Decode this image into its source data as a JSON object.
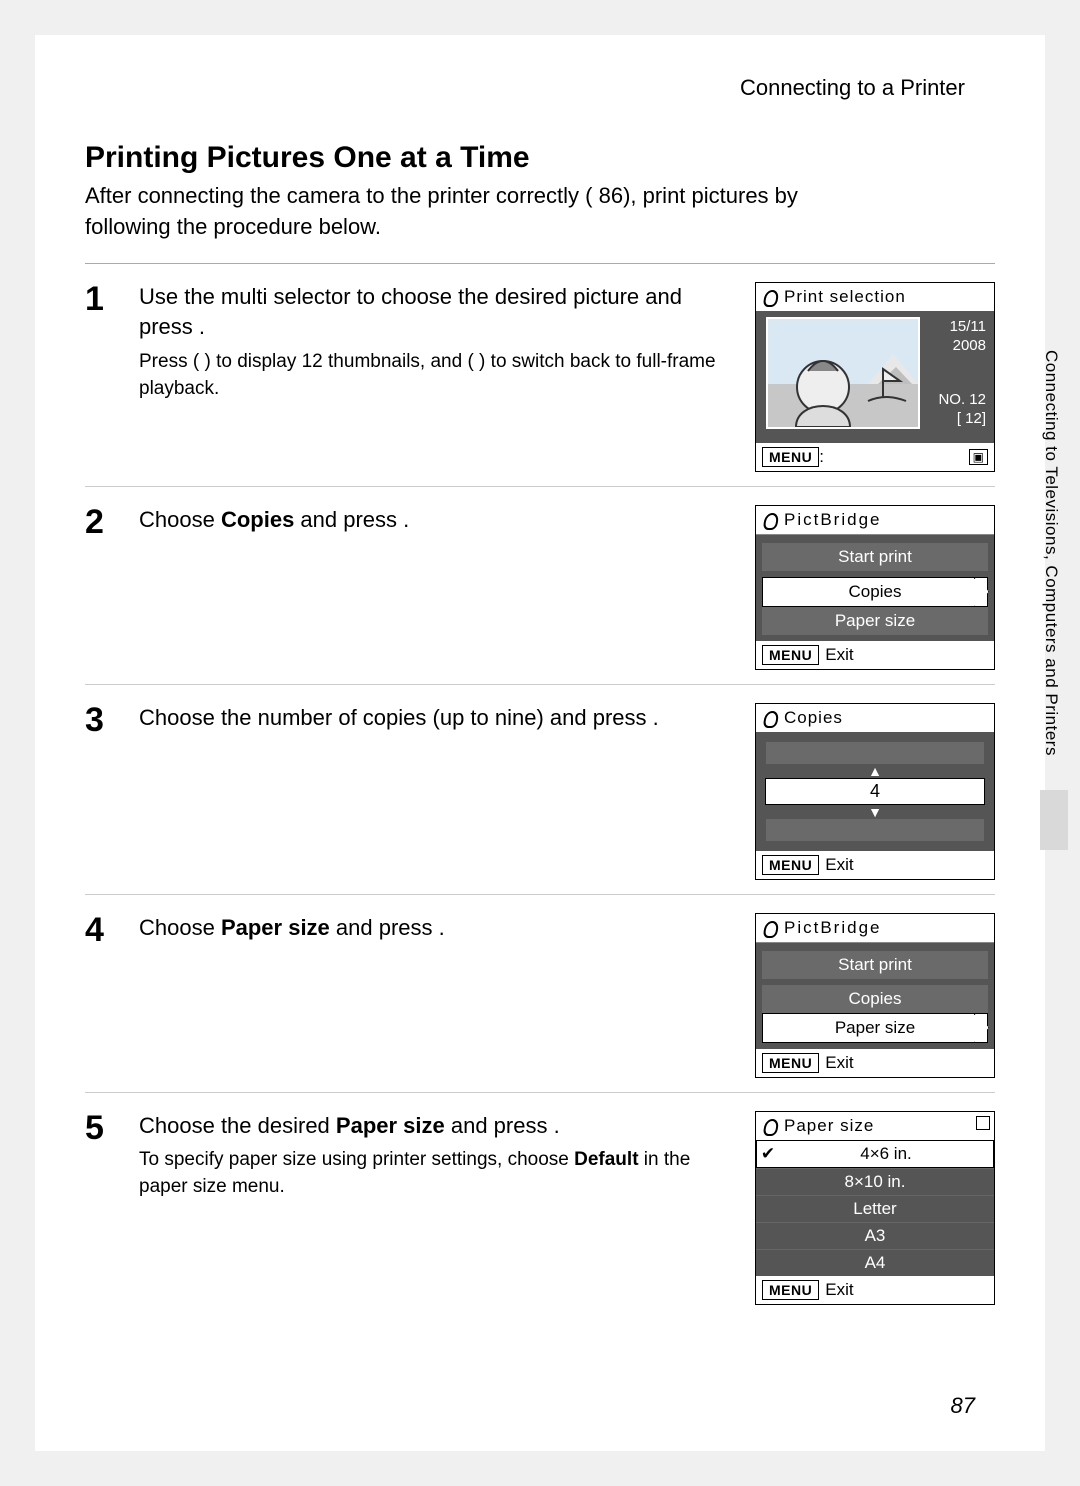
{
  "running_head": "Connecting to a Printer",
  "side_tab": "Connecting to Televisions, Computers and Printers",
  "page_number": "87",
  "section_title": "Printing Pictures One at a Time",
  "intro_a": "After connecting the camera to the printer correctly (",
  "intro_ref": "86",
  "intro_b": "), print pictures by following the procedure below.",
  "steps": {
    "s1": {
      "num": "1",
      "head_a": "Use the multi selector to choose the desired picture and press ",
      "head_b": ".",
      "note_a": "Press ",
      "note_b": " ( ) to display 12 thumbnails, and ",
      "note_c": " ( ) to switch back to full-frame playback."
    },
    "s2": {
      "num": "2",
      "head_a": "Choose ",
      "bold": "Copies",
      "head_b": " and press ",
      "head_c": "."
    },
    "s3": {
      "num": "3",
      "head_a": "Choose the number of copies (up to nine) and press ",
      "head_b": "."
    },
    "s4": {
      "num": "4",
      "head_a": "Choose ",
      "bold": "Paper size",
      "head_b": " and press ",
      "head_c": "."
    },
    "s5": {
      "num": "5",
      "head_a": "Choose the desired ",
      "bold": "Paper size",
      "head_b": " and press ",
      "head_c": ".",
      "note_a": "To specify paper size using printer settings, choose ",
      "note_bold": "Default",
      "note_b": " in the paper size menu."
    }
  },
  "screens": {
    "s1": {
      "title": "Print selection",
      "date1": "15/11",
      "date2": "2008",
      "no_label": "NO. 12",
      "count": "[  12]",
      "menu": "MENU",
      "menu_sub": ":"
    },
    "pb": {
      "title": "PictBridge",
      "opt_start": "Start print",
      "opt_copies": "Copies",
      "opt_paper": "Paper size",
      "exit": "Exit",
      "menu": "MENU"
    },
    "copies": {
      "title": "Copies",
      "value": "4",
      "exit": "Exit",
      "menu": "MENU"
    },
    "paper": {
      "title": "Paper size",
      "opts": [
        "4×6 in.",
        "8×10 in.",
        "Letter",
        "A3",
        "A4"
      ],
      "exit": "Exit",
      "menu": "MENU"
    }
  }
}
